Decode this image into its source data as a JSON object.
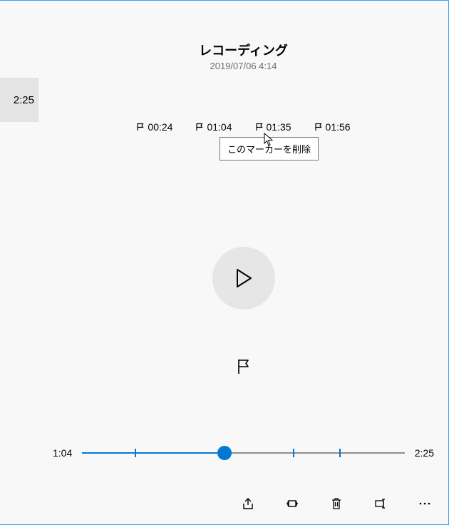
{
  "window_controls": {
    "minimize": "minimize",
    "maximize": "maximize",
    "close": "close"
  },
  "sidebar": {
    "item_duration": "2:25"
  },
  "recording": {
    "title": "レコーディング",
    "datetime": "2019/07/06 4:14"
  },
  "markers": [
    {
      "time": "00:24",
      "position_pct": 16.55
    },
    {
      "time": "01:04",
      "position_pct": 44.14
    },
    {
      "time": "01:35",
      "position_pct": 65.52
    },
    {
      "time": "01:56",
      "position_pct": 80.0
    }
  ],
  "tooltip_text": "このマーカーを削除",
  "playback": {
    "current_time": "1:04",
    "total_time": "2:25",
    "progress_pct": 44.14
  },
  "colors": {
    "accent": "#0078d4",
    "bg": "#f8f8f8",
    "selected_bg": "#e4e4e4"
  },
  "toolbar": {
    "share": "共有",
    "trim": "トリミング",
    "delete": "削除",
    "rename": "名前の変更",
    "more": "…"
  }
}
